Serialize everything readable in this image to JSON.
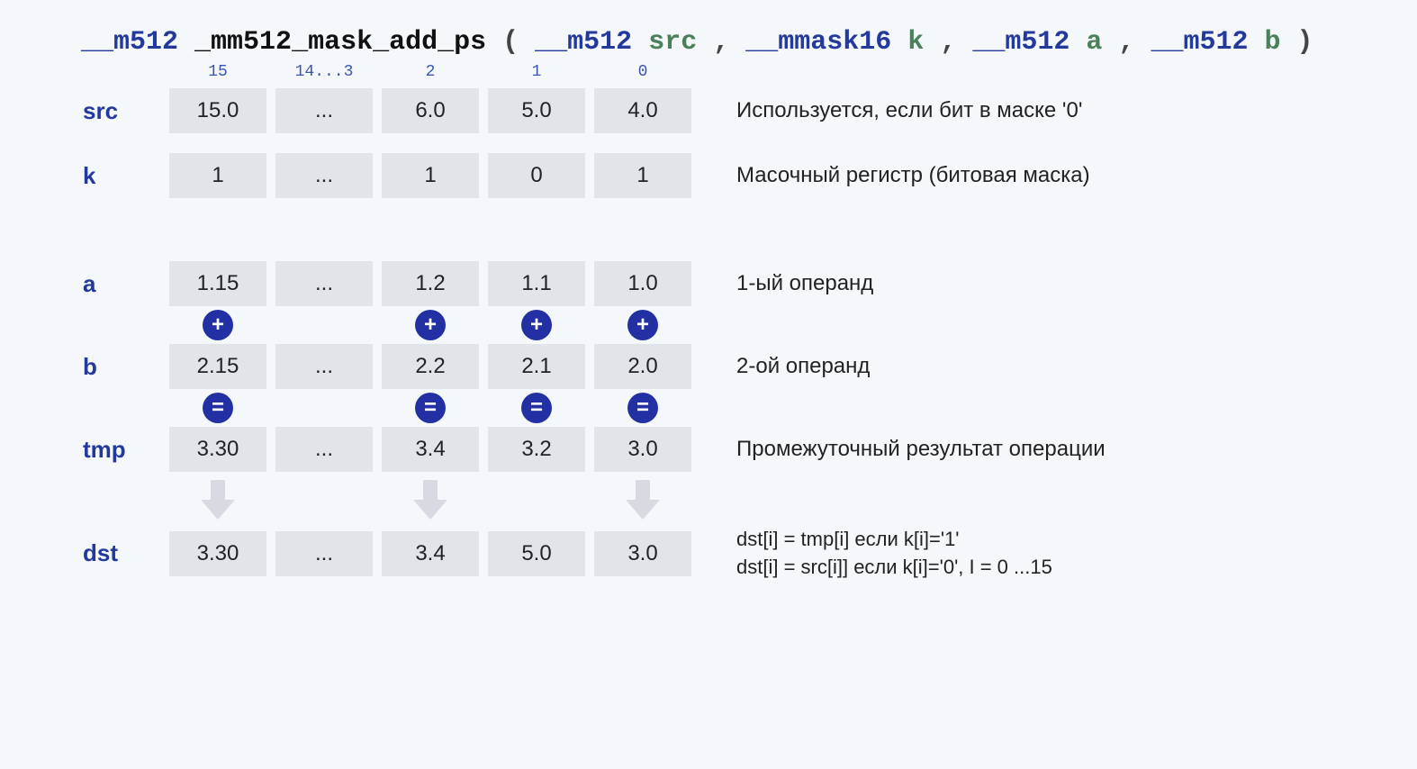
{
  "signature": {
    "ret_type": "__m512",
    "func_name": "_mm512_mask_add_ps",
    "open": "(",
    "close": ")",
    "params": [
      {
        "type": "__m512",
        "name": "src"
      },
      {
        "type": "__mmask16",
        "name": "k"
      },
      {
        "type": "__m512",
        "name": "a"
      },
      {
        "type": "__m512",
        "name": "b"
      }
    ]
  },
  "indices": [
    "15",
    "14...3",
    "2",
    "1",
    "0"
  ],
  "rows": {
    "src": {
      "label": "src",
      "cells": [
        "15.0",
        "...",
        "6.0",
        "5.0",
        "4.0"
      ],
      "desc": "Используется, если бит в маске '0'"
    },
    "k": {
      "label": "k",
      "cells": [
        "1",
        "...",
        "1",
        "0",
        "1"
      ],
      "desc": "Масочный регистр (битовая маска)"
    },
    "a": {
      "label": "a",
      "cells": [
        "1.15",
        "...",
        "1.2",
        "1.1",
        "1.0"
      ],
      "desc": "1-ый операнд"
    },
    "b": {
      "label": "b",
      "cells": [
        "2.15",
        "...",
        "2.2",
        "2.1",
        "2.0"
      ],
      "desc": "2-ой операнд"
    },
    "tmp": {
      "label": "tmp",
      "cells": [
        "3.30",
        "...",
        "3.4",
        "3.2",
        "3.0"
      ],
      "desc": "Промежуточный результат операции"
    },
    "dst": {
      "label": "dst",
      "cells": [
        "3.30",
        "...",
        "3.4",
        "5.0",
        "3.0"
      ]
    }
  },
  "ops": {
    "plus": {
      "symbol": "+",
      "slots": [
        true,
        false,
        true,
        true,
        true
      ]
    },
    "equal": {
      "symbol": "=",
      "slots": [
        true,
        false,
        true,
        true,
        true
      ]
    },
    "arrow": {
      "slots": [
        true,
        false,
        true,
        false,
        true
      ]
    }
  },
  "dst_desc": {
    "line1": "dst[i]   =  tmp[i] если k[i]='1'",
    "line2": "dst[i]   =  src[i]] если k[i]='0',   I = 0 ...15"
  }
}
